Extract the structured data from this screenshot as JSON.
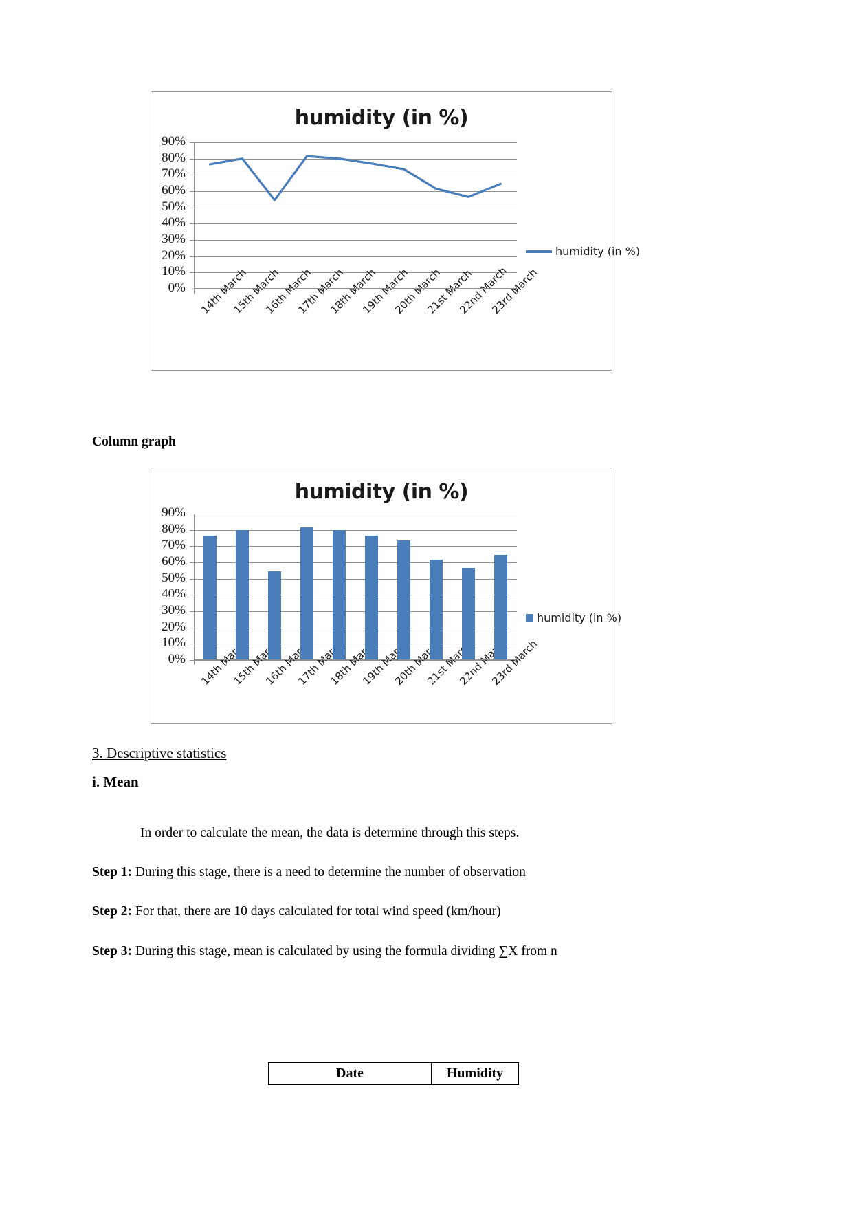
{
  "charts": [
    {
      "title": "humidity (in %)",
      "legend_label": "humidity (in %)",
      "kind": "line"
    },
    {
      "title": "humidity (in %)",
      "legend_label": "humidity (in %)",
      "kind": "bar"
    }
  ],
  "chart_data": [
    {
      "type": "line",
      "title": "humidity (in %)",
      "xlabel": "",
      "ylabel": "",
      "ylim": [
        0,
        90
      ],
      "ytick_labels": [
        "90%",
        "80%",
        "70%",
        "60%",
        "50%",
        "40%",
        "30%",
        "20%",
        "10%",
        "0%"
      ],
      "ytick_values": [
        90,
        80,
        70,
        60,
        50,
        40,
        30,
        20,
        10,
        0
      ],
      "grid": true,
      "legend_position": "right",
      "categories": [
        "14th March",
        "15th March",
        "16th March",
        "17th March",
        "18th March",
        "19th March",
        "20th March",
        "21st  March",
        "22nd March",
        "23rd March"
      ],
      "series": [
        {
          "name": "humidity (in %)",
          "color": "#4a7ebb",
          "values": [
            76.5,
            80,
            54.5,
            81.5,
            80,
            77,
            73.5,
            61.5,
            56.5,
            64.5
          ]
        }
      ]
    },
    {
      "type": "bar",
      "title": "humidity (in %)",
      "xlabel": "",
      "ylabel": "",
      "ylim": [
        0,
        90
      ],
      "ytick_labels": [
        "90%",
        "80%",
        "70%",
        "60%",
        "50%",
        "40%",
        "30%",
        "20%",
        "10%",
        "0%"
      ],
      "ytick_values": [
        90,
        80,
        70,
        60,
        50,
        40,
        30,
        20,
        10,
        0
      ],
      "grid": true,
      "legend_position": "right",
      "categories": [
        "14th March",
        "15th March",
        "16th March",
        "17th March",
        "18th March",
        "19th March",
        "20th March",
        "21st  March",
        "22nd March",
        "23rd March"
      ],
      "series": [
        {
          "name": "humidity (in %)",
          "color": "#4a7ebb",
          "values": [
            76.5,
            80,
            54.5,
            81.5,
            80,
            76.5,
            73.5,
            61.5,
            56.5,
            64.5
          ]
        }
      ]
    }
  ],
  "body": {
    "column_graph_caption": "Column graph",
    "section_heading": "3. Descriptive statistics",
    "subsection_heading": "i. Mean",
    "intro_paragraph": "In order to calculate the mean, the data is determine through this steps.",
    "steps": [
      {
        "label": "Step 1:",
        "text": " During this stage, there is a need to determine the number of observation"
      },
      {
        "label": "Step 2:",
        "text": " For that, there are 10 days calculated for total wind speed (km/hour)"
      },
      {
        "label": "Step 3:",
        "text": " During this stage, mean is calculated by using the formula dividing ∑X from n"
      }
    ]
  },
  "table": {
    "headers": [
      "Date",
      "Humidity"
    ]
  },
  "colors": {
    "series": "#4a7ebb",
    "grid": "#919191",
    "frame_border": "#9a9a9a",
    "text": "#000000"
  }
}
